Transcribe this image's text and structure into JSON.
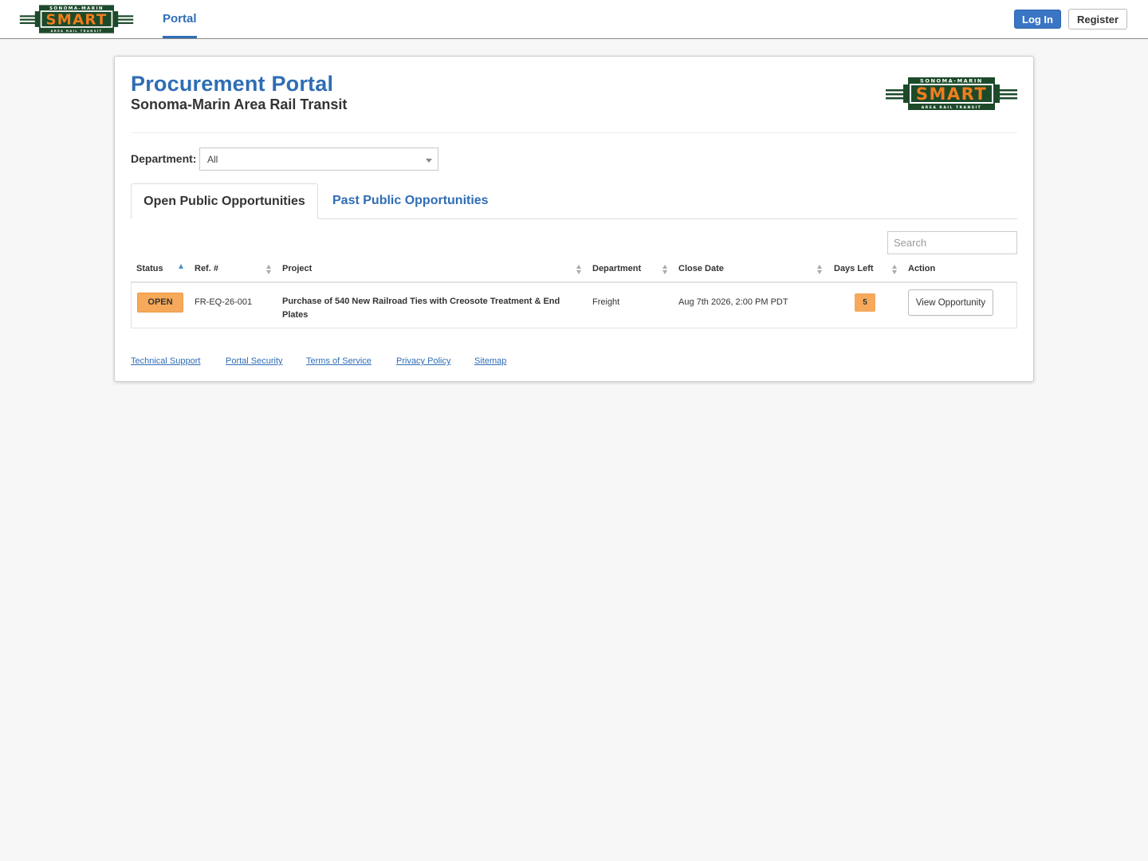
{
  "nav": {
    "logo_alt": "SMART",
    "portal_tab": "Portal",
    "login_label": "Log In",
    "register_label": "Register"
  },
  "logo": {
    "top_text": "SONOMA-MARIN",
    "main_text": "SMART",
    "bottom_text": "AREA RAIL TRANSIT",
    "colors": {
      "green": "#1d4a2a",
      "orange": "#f07d1d",
      "white": "#ffffff",
      "black": "#111111"
    }
  },
  "header": {
    "title": "Procurement Portal",
    "subtitle": "Sonoma-Marin Area Rail Transit"
  },
  "filter": {
    "department_label": "Department:",
    "department_value": "All"
  },
  "tabs": [
    {
      "label": "Open Public Opportunities",
      "active": true
    },
    {
      "label": "Past Public Opportunities",
      "active": false
    }
  ],
  "search": {
    "placeholder": "Search"
  },
  "table": {
    "columns": [
      "Status",
      "Ref. #",
      "Project",
      "Department",
      "Close Date",
      "Days Left",
      "Action"
    ],
    "rows": [
      {
        "status": "OPEN",
        "ref": "FR-EQ-26-001",
        "project": "Purchase of 540 New Railroad Ties with Creosote Treatment & End Plates",
        "department": "Freight",
        "close_date": "Aug 7th 2026, 2:00 PM PDT",
        "days_left": "5",
        "action": "View Opportunity"
      }
    ]
  },
  "footer": {
    "links": [
      "Technical Support",
      "Portal Security",
      "Terms of Service",
      "Privacy Policy",
      "Sitemap"
    ]
  },
  "colors": {
    "accent": "#2f6db5",
    "status_open": "#f6a95a",
    "page_bg": "#f7f7f7"
  }
}
